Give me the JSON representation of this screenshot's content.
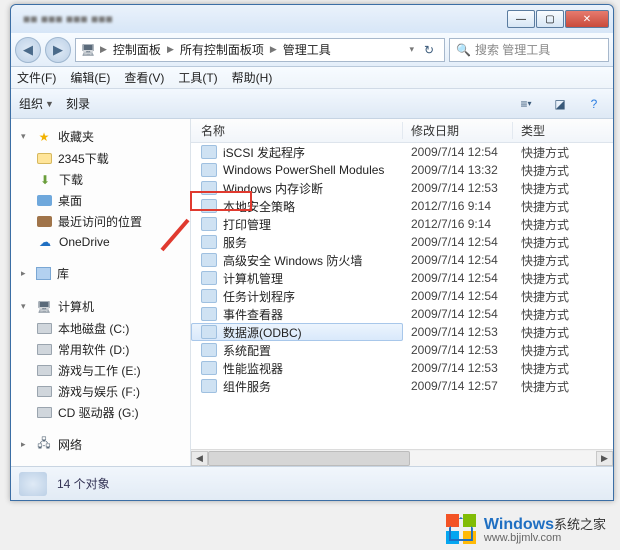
{
  "breadcrumb": {
    "c1": "控制面板",
    "c2": "所有控制面板项",
    "c3": "管理工具"
  },
  "search": {
    "placeholder": "搜索 管理工具"
  },
  "menubar": {
    "file": "文件(F)",
    "edit": "编辑(E)",
    "view": "查看(V)",
    "tools": "工具(T)",
    "help": "帮助(H)"
  },
  "toolbar": {
    "organize": "组织",
    "burn": "刻录"
  },
  "sidebar": {
    "fav": "收藏夹",
    "fav_items": [
      "2345下载",
      "下载",
      "桌面",
      "最近访问的位置",
      "OneDrive"
    ],
    "lib": "库",
    "pc": "计算机",
    "drives": [
      "本地磁盘 (C:)",
      "常用软件 (D:)",
      "游戏与工作 (E:)",
      "游戏与娱乐 (F:)",
      "CD 驱动器 (G:)"
    ],
    "net": "网络"
  },
  "columns": {
    "name": "名称",
    "date": "修改日期",
    "type": "类型"
  },
  "items": [
    {
      "name": "iSCSI 发起程序",
      "date": "2009/7/14 12:54",
      "type": "快捷方式"
    },
    {
      "name": "Windows PowerShell Modules",
      "date": "2009/7/14 13:32",
      "type": "快捷方式"
    },
    {
      "name": "Windows 内存诊断",
      "date": "2009/7/14 12:53",
      "type": "快捷方式"
    },
    {
      "name": "本地安全策略",
      "date": "2012/7/16 9:14",
      "type": "快捷方式"
    },
    {
      "name": "打印管理",
      "date": "2012/7/16 9:14",
      "type": "快捷方式"
    },
    {
      "name": "服务",
      "date": "2009/7/14 12:54",
      "type": "快捷方式",
      "hl": true
    },
    {
      "name": "高级安全 Windows 防火墙",
      "date": "2009/7/14 12:54",
      "type": "快捷方式"
    },
    {
      "name": "计算机管理",
      "date": "2009/7/14 12:54",
      "type": "快捷方式"
    },
    {
      "name": "任务计划程序",
      "date": "2009/7/14 12:54",
      "type": "快捷方式"
    },
    {
      "name": "事件查看器",
      "date": "2009/7/14 12:54",
      "type": "快捷方式"
    },
    {
      "name": "数据源(ODBC)",
      "date": "2009/7/14 12:53",
      "type": "快捷方式",
      "sel": true
    },
    {
      "name": "系统配置",
      "date": "2009/7/14 12:53",
      "type": "快捷方式"
    },
    {
      "name": "性能监视器",
      "date": "2009/7/14 12:53",
      "type": "快捷方式"
    },
    {
      "name": "组件服务",
      "date": "2009/7/14 12:57",
      "type": "快捷方式"
    }
  ],
  "status": {
    "count": "14 个对象"
  },
  "watermark": {
    "brand": "Windows",
    "sub": "系统之家",
    "site": "www.bjjmlv.com"
  }
}
